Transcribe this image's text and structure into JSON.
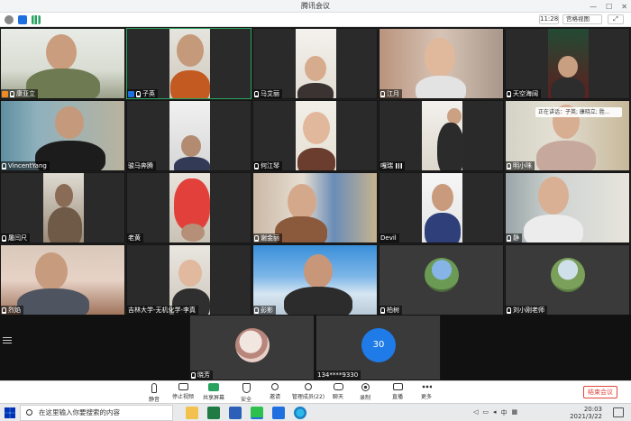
{
  "window": {
    "title": "腾讯会议",
    "controls": [
      "—",
      "☐",
      "✕"
    ]
  },
  "status": {
    "time": "11:28",
    "view_label": "宫格视图",
    "fullscreen_label": "⤢"
  },
  "speaking": {
    "text": "正在讲话：子英; 康晓立; 胜..."
  },
  "participants": [
    {
      "name": "康亚立",
      "host": true
    },
    {
      "name": "子英",
      "host": true
    },
    {
      "name": "马艾丽",
      "host": false
    },
    {
      "name": "江月",
      "host": false
    },
    {
      "name": "天空海阔",
      "host": false
    },
    {
      "name": "VincentYang",
      "host": false
    },
    {
      "name": "骏马奔腾",
      "host": false
    },
    {
      "name": "何江琴",
      "host": false
    },
    {
      "name": "嘎瑞",
      "host": false
    },
    {
      "name": "明小咪",
      "host": false
    },
    {
      "name": "屠闫尺",
      "host": false
    },
    {
      "name": "老黄",
      "host": false
    },
    {
      "name": "谢金丽",
      "host": false
    },
    {
      "name": "Devil",
      "host": false
    },
    {
      "name": "静",
      "host": false
    },
    {
      "name": "烈焰",
      "host": false
    },
    {
      "name": "吉林大学-无机化学-李真",
      "host": false
    },
    {
      "name": "彭影",
      "host": false
    },
    {
      "name": "柏树",
      "host": false
    },
    {
      "name": "刘小刚老师",
      "host": false
    },
    {
      "name": "晓芳",
      "host": false
    },
    {
      "name": "134****9330",
      "host": false
    }
  ],
  "avatar_badge": "30",
  "toolbar": {
    "items": [
      {
        "label": "静音",
        "icon": "microphone-icon"
      },
      {
        "label": "停止视频",
        "icon": "camera-icon"
      },
      {
        "label": "共享屏幕",
        "icon": "screen-share-icon"
      },
      {
        "label": "安全",
        "icon": "shield-icon"
      },
      {
        "label": "邀请",
        "icon": "invite-icon"
      },
      {
        "label": "管理成员(22)",
        "icon": "members-icon"
      },
      {
        "label": "聊天",
        "icon": "chat-icon"
      },
      {
        "label": "录制",
        "icon": "record-icon"
      },
      {
        "label": "直播",
        "icon": "live-icon"
      },
      {
        "label": "更多",
        "icon": "more-icon"
      }
    ],
    "end_label": "结束会议"
  },
  "taskbar": {
    "search_placeholder": "在这里输入你要搜索的内容",
    "ime": "中",
    "time": "20:03",
    "date": "2021/3/22"
  },
  "colors": {
    "accent": "#1e6fe0",
    "end_red": "#e0463c",
    "active_border": "#27a35f",
    "badge_blue": "#1e7be8"
  }
}
